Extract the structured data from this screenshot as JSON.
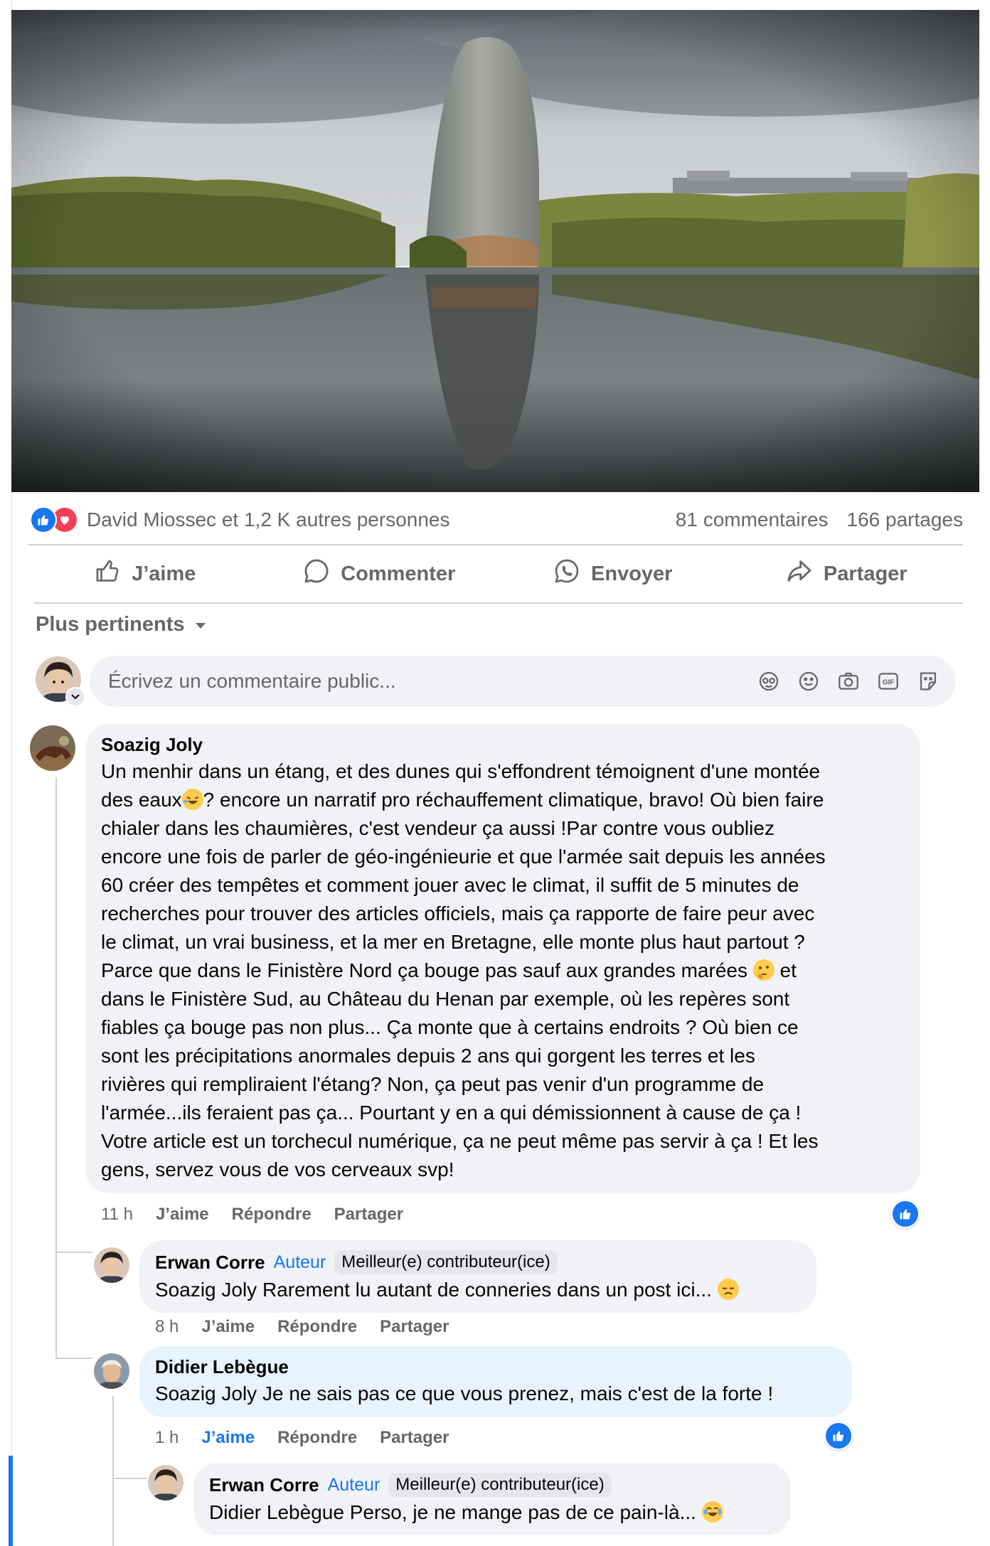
{
  "post": {
    "reactions": {
      "names_text": "David Miossec et 1,2 K autres personnes",
      "comments_count": "81 commentaires",
      "shares_count": "166 partages"
    },
    "actions": {
      "like": "J’aime",
      "comment": "Commenter",
      "send": "Envoyer",
      "share": "Partager"
    },
    "sort_label": "Plus pertinents",
    "composer_placeholder": "Écrivez un commentaire public..."
  },
  "comments": [
    {
      "author": "Soazig Joly",
      "text_lines": [
        "Un menhir dans un étang, et des dunes qui s'effondrent témoignent d'une montée",
        "des eaux",
        "? encore un narratif pro réchauffement climatique, bravo! Où bien faire",
        "chialer dans les chaumières, c'est vendeur ça aussi !Par contre vous oubliez",
        "encore une fois de parler de géo-ingénieurie et que l'armée sait depuis les années",
        "60 créer des tempêtes et comment jouer avec le climat, il suffit de 5 minutes de",
        "recherches pour trouver des articles officiels, mais ça rapporte de faire peur avec",
        "le climat, un vrai business, et la mer en Bretagne, elle monte plus haut partout ?",
        "Parce que dans le Finistère Nord ça bouge pas sauf aux grandes marées",
        "et",
        "dans le Finistère Sud, au Château du Henan par exemple, où les repères sont",
        "fiables ça bouge pas non plus... Ça monte que à certains endroits ? Où bien ce",
        "sont les précipitations anormales depuis 2 ans qui gorgent les terres et les",
        "rivières qui rempliraient l'étang? Non, ça peut pas venir d'un programme de",
        "l'armée...ils feraient pas ça... Pourtant y en a qui démissionnent à cause de ça !",
        "Votre article est un torchecul numérique, ça ne peut même pas servir à ça ! Et les",
        "gens, servez vous de vos cerveaux svp!"
      ],
      "time": "11 h",
      "like": "J’aime",
      "reply": "Répondre",
      "share": "Partager"
    },
    {
      "author": "Erwan Corre",
      "author_tag": "Auteur",
      "badge": "Meilleur(e) contributeur(ice)",
      "text": "Soazig Joly Rarement lu autant de conneries dans un post ici...",
      "time": "8 h",
      "like": "J’aime",
      "reply": "Répondre",
      "share": "Partager"
    },
    {
      "author": "Didier Lebègue",
      "text": "Soazig Joly Je ne sais pas ce que vous prenez, mais c'est de la forte !",
      "time": "1 h",
      "like": "J’aime",
      "reply": "Répondre",
      "share": "Partager"
    },
    {
      "author": "Erwan Corre",
      "author_tag": "Auteur",
      "badge": "Meilleur(e) contributeur(ice)",
      "text": "Didier Lebègue Perso, je ne mange pas de ce pain-là..."
    }
  ],
  "colors": {
    "accent": "#1877f2",
    "love": "#f33e58",
    "secondary_text": "#65676b",
    "bubble_bg": "#f0f2f5",
    "highlight_bg": "#e7f3ff"
  },
  "icons": {
    "reaction_like": "like-reaction-icon",
    "reaction_love": "love-reaction-icon",
    "action_like": "thumbs-up-icon",
    "action_comment": "comment-icon",
    "action_send": "whatsapp-icon",
    "action_share": "share-icon",
    "sort": "caret-down-icon",
    "composer_tools": [
      "avatar-sticker-icon",
      "emoji-icon",
      "camera-icon",
      "gif-icon",
      "sticker-icon"
    ]
  }
}
